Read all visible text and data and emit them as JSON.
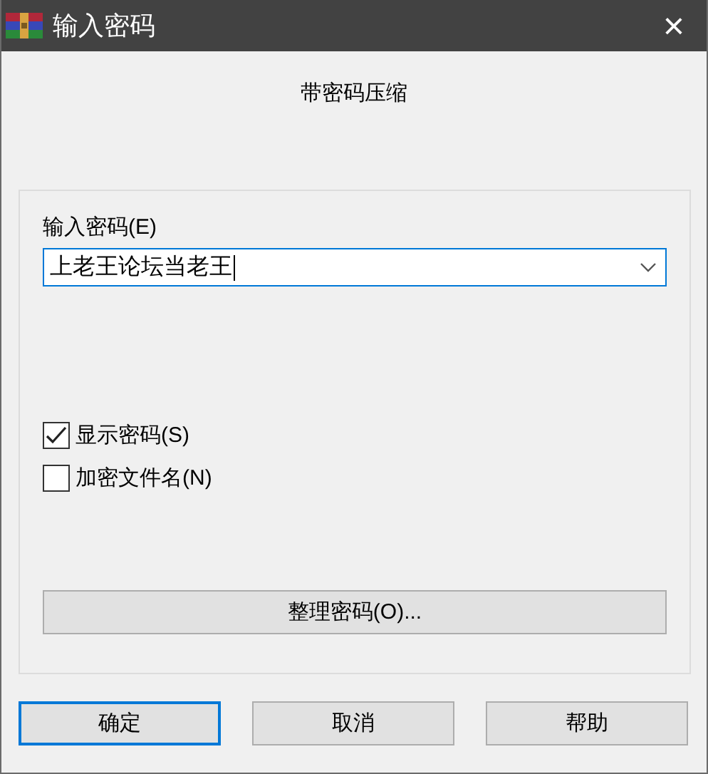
{
  "window": {
    "title": "输入密码",
    "close": "×"
  },
  "subtitle": "带密码压缩",
  "password": {
    "label": "输入密码(E)",
    "value": "上老王论坛当老王"
  },
  "options": [
    {
      "label": "显示密码(S)",
      "checked": true
    },
    {
      "label": "加密文件名(N)",
      "checked": false
    }
  ],
  "manage_button": "整理密码(O)...",
  "buttons": [
    {
      "label": "确定",
      "default": true
    },
    {
      "label": "取消",
      "default": false
    },
    {
      "label": "帮助",
      "default": false
    }
  ]
}
